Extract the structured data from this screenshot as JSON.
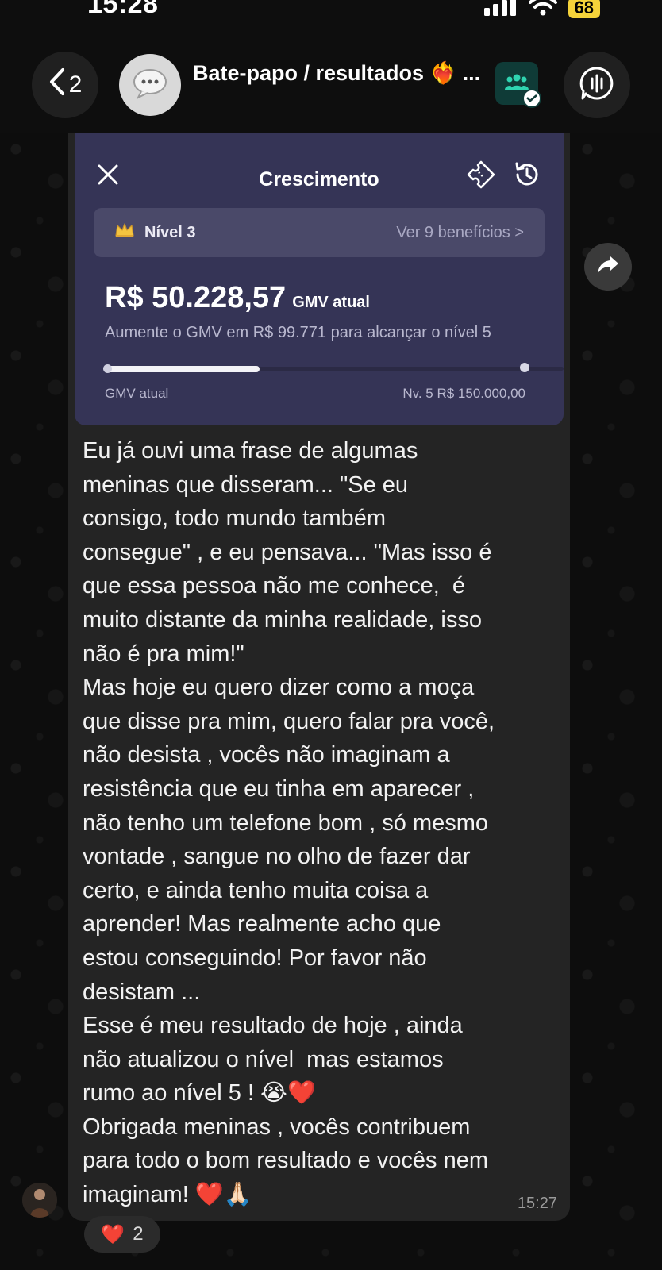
{
  "status_bar": {
    "time": "15:28",
    "battery": "68"
  },
  "header": {
    "back_count": "2",
    "chat_title": "Bate-papo / resultados ❤️‍🔥 ..."
  },
  "growth_card": {
    "title": "Crescimento",
    "level_label": "Nível 3",
    "benefits_link": "Ver 9 benefícios >",
    "gmv_value": "R$ 50.228,57",
    "gmv_label": "GMV atual",
    "gmv_hint": "Aumente o GMV em R$ 99.771 para alcançar o nível 5",
    "progress_fraction": 0.335,
    "progress_start_label": "GMV atual",
    "progress_end_label": "Nv. 5 R$ 150.000,00"
  },
  "message": {
    "text": "Eu já ouvi uma frase de algumas\nmeninas que disseram... \"Se eu\nconsigo, todo mundo também\nconsegue\" , e eu pensava... \"Mas isso é\nque essa pessoa não me conhece,  é\nmuito distante da minha realidade, isso\nnão é pra mim!\"\nMas hoje eu quero dizer como a moça\nque disse pra mim, quero falar pra você,\nnão desista , vocês não imaginam a\nresistência que eu tinha em aparecer ,\nnão tenho um telefone bom , só mesmo\nvontade , sangue no olho de fazer dar\ncerto, e ainda tenho muita coisa a\naprender! Mas realmente acho que\nestou conseguindo! Por favor não\ndesistam ...\nEsse é meu resultado de hoje , ainda\nnão atualizou o nível  mas estamos\nrumo ao nível 5 ! 😭❤️\nObrigada meninas , vocês contribuem\npara todo o bom resultado e vocês nem\nimaginam! ❤️🙏🏻",
    "time": "15:27"
  },
  "reaction": {
    "emoji": "❤️",
    "count": "2"
  },
  "colors": {
    "card_bg": "#353456",
    "bubble_bg": "#242424",
    "battery": "#f5d33a",
    "community": "#0f3b37"
  }
}
